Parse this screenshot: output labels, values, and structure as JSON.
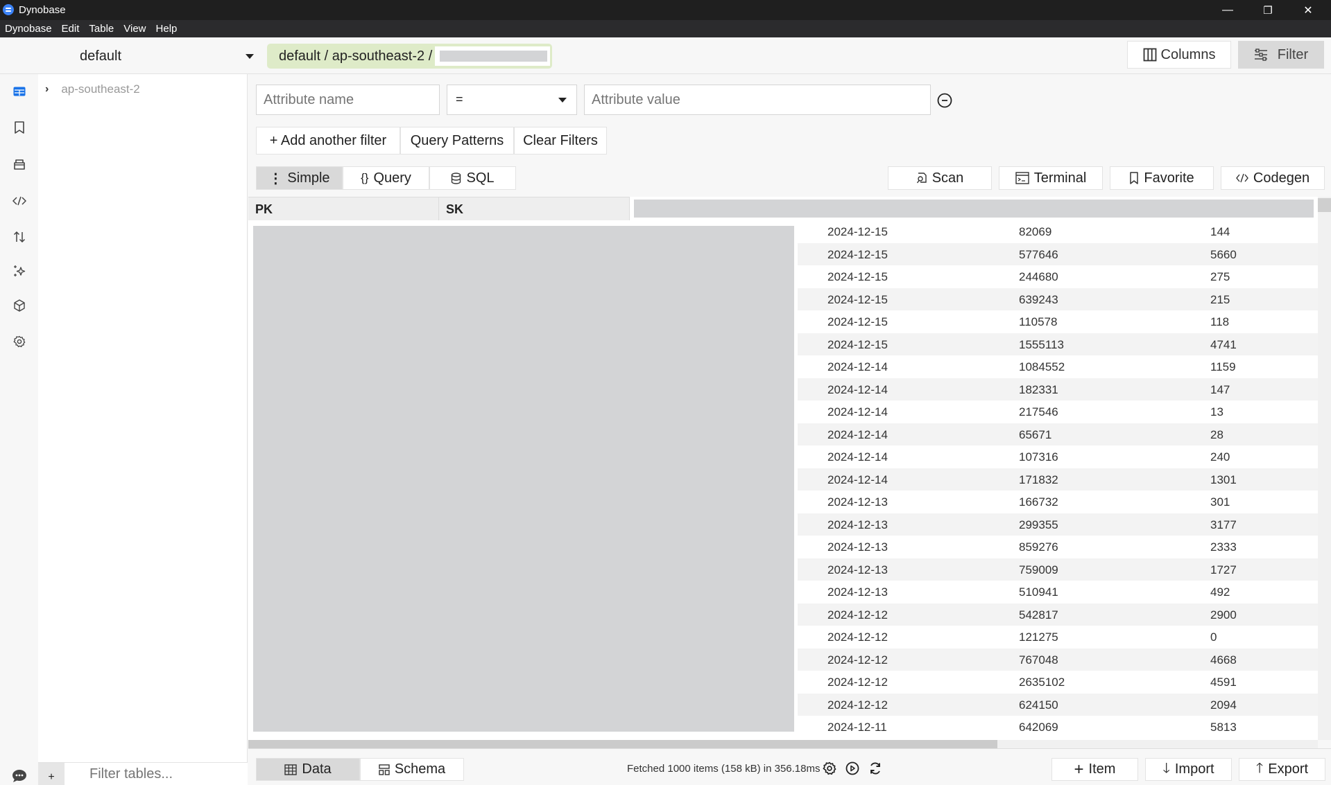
{
  "window": {
    "title": "Dynobase",
    "controls": {
      "minimize": "—",
      "restore": "❐",
      "close": "✕"
    }
  },
  "menu": [
    "Dynobase",
    "Edit",
    "Table",
    "View",
    "Help"
  ],
  "toolbar": {
    "profile": "default",
    "breadcrumb": "default / ap-southeast-2 /",
    "columns_label": "Columns",
    "filter_label": "Filter"
  },
  "sidebar": {
    "rail_icons": [
      "tables-icon",
      "bookmark-icon",
      "database-icon",
      "code-icon",
      "transfer-icon",
      "sparkles-icon",
      "cube-icon",
      "settings-icon",
      "chat-icon"
    ],
    "tree": [
      {
        "label": "ap-southeast-2",
        "expanded": false
      }
    ],
    "filter_placeholder": "Filter tables...",
    "add_label": "+"
  },
  "filter": {
    "attribute_name_placeholder": "Attribute name",
    "operator": "=",
    "attribute_value_placeholder": "Attribute value",
    "add_filter_label": "+ Add another filter",
    "query_patterns_label": "Query Patterns",
    "clear_filters_label": "Clear Filters"
  },
  "modes": {
    "simple_label": "Simple",
    "query_label": "Query",
    "sql_label": "SQL",
    "active": "Simple"
  },
  "actions": {
    "scan_label": "Scan",
    "terminal_label": "Terminal",
    "favorite_label": "Favorite",
    "codegen_label": "Codegen"
  },
  "table": {
    "columns": [
      "PK",
      "SK"
    ],
    "rows": [
      [
        "2024-12-15",
        "82069",
        "144"
      ],
      [
        "2024-12-15",
        "577646",
        "5660"
      ],
      [
        "2024-12-15",
        "244680",
        "275"
      ],
      [
        "2024-12-15",
        "639243",
        "215"
      ],
      [
        "2024-12-15",
        "110578",
        "118"
      ],
      [
        "2024-12-15",
        "1555113",
        "4741"
      ],
      [
        "2024-12-14",
        "1084552",
        "1159"
      ],
      [
        "2024-12-14",
        "182331",
        "147"
      ],
      [
        "2024-12-14",
        "217546",
        "13"
      ],
      [
        "2024-12-14",
        "65671",
        "28"
      ],
      [
        "2024-12-14",
        "107316",
        "240"
      ],
      [
        "2024-12-14",
        "171832",
        "1301"
      ],
      [
        "2024-12-13",
        "166732",
        "301"
      ],
      [
        "2024-12-13",
        "299355",
        "3177"
      ],
      [
        "2024-12-13",
        "859276",
        "2333"
      ],
      [
        "2024-12-13",
        "759009",
        "1727"
      ],
      [
        "2024-12-13",
        "510941",
        "492"
      ],
      [
        "2024-12-12",
        "542817",
        "2900"
      ],
      [
        "2024-12-12",
        "121275",
        "0"
      ],
      [
        "2024-12-12",
        "767048",
        "4668"
      ],
      [
        "2024-12-12",
        "2635102",
        "4591"
      ],
      [
        "2024-12-12",
        "624150",
        "2094"
      ],
      [
        "2024-12-11",
        "642069",
        "5813"
      ]
    ]
  },
  "footer": {
    "data_tab": "Data",
    "schema_tab": "Schema",
    "active_tab": "Data",
    "status": "Fetched 1000 items (158 kB) in 356.18ms",
    "add_item_label": "Item",
    "import_label": "Import",
    "export_label": "Export"
  },
  "colors": {
    "accent": "#1a73e8",
    "breadcrumb_bg": "#deebc8",
    "redacted": "#d3d4d6"
  }
}
